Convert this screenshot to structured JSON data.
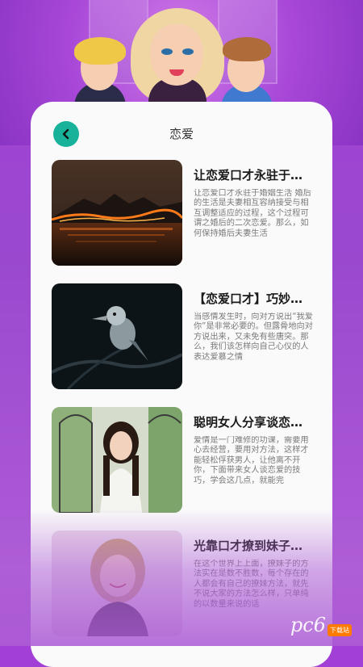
{
  "header": {
    "title": "恋爱"
  },
  "articles": [
    {
      "title": "让恋爱口才永驻于…",
      "desc": "让恋爱口才永驻于婚姻生活 婚后的生活是夫妻相互容纳接受与相互调整适应的过程，这个过程可谓之婚后的二次恋爱。那么，如何保持婚后夫妻生活",
      "image": "forest-fire-photo"
    },
    {
      "title": "【恋爱口才】巧妙…",
      "desc": "当感情发生时，向对方说出“我爱你”是非常必要的。但露骨地向对方说出来，又未免有些唐突。那么，我们该怎样向自己心仪的人表达爱慕之情",
      "image": "kookaburra-bird-photo"
    },
    {
      "title": "聪明女人分享谈恋…",
      "desc": "爱情是一门难修的功课，需要用心去经营，要用对方法，这样才能轻松俘获男人，让他离不开你，下面带来女人谈恋爱的技巧，学会这几点，就能完",
      "image": "woman-garden-photo"
    },
    {
      "title": "光靠口才撩到妹子…",
      "desc": "在这个世界上上面，撩妹子的方法实在是数不胜数，每个存在的人都会有自己的撩妹方法，就先不说大家的方法怎么样，只单纯的以数量来说的话",
      "image": "smiling-woman-photo"
    }
  ],
  "watermark": {
    "text": "pc6",
    "badge": "下载站"
  },
  "colors": {
    "accent": "#18b29a",
    "background": "#a23fd6",
    "card": "#fafafa"
  }
}
